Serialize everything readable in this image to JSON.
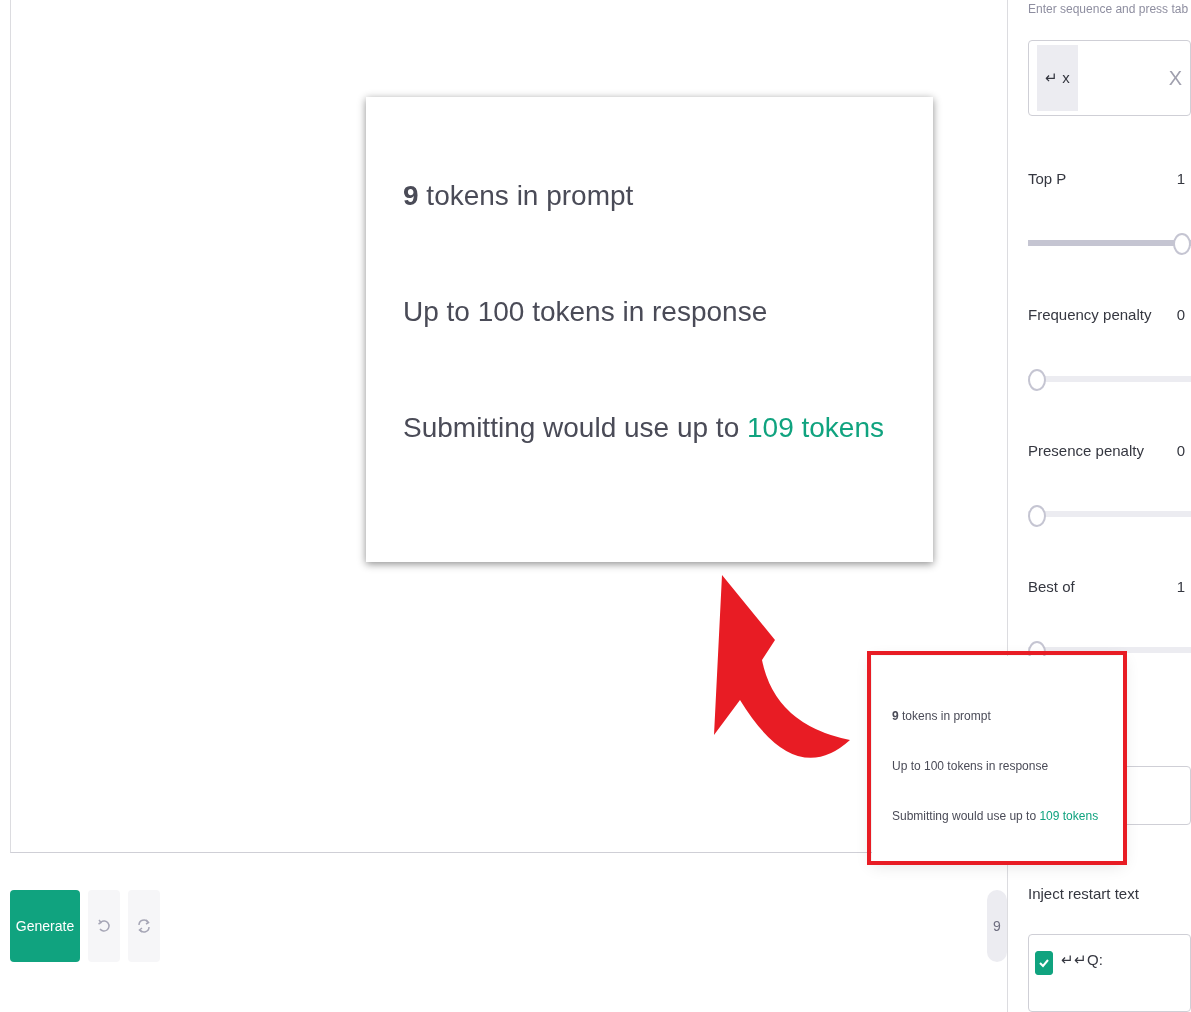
{
  "sidebar": {
    "stop_sequences": {
      "label": "Enter sequence and press tab",
      "chips": [
        {
          "text": "↵ x"
        }
      ],
      "clear": "X"
    },
    "sliders": [
      {
        "label": "Top P",
        "value": "1",
        "level": 1
      },
      {
        "label": "Frequency penalty",
        "value": "0",
        "level": 0
      },
      {
        "label": "Presence penalty",
        "value": "0",
        "level": 0
      },
      {
        "label": "Best of",
        "value": "1",
        "level": 0
      }
    ],
    "inject_restart": {
      "label": "Inject restart text",
      "checked": true,
      "value": "↵↵Q:"
    }
  },
  "toolbar": {
    "generate": "Generate",
    "token_count": "9"
  },
  "token_tooltip": {
    "lines": [
      {
        "text": "**9** tokens in prompt"
      },
      {
        "text": "Up to 100 tokens in response"
      },
      {
        "text": "Submitting would use up to ",
        "highlight": "109 tokens"
      }
    ]
  },
  "callout": {
    "lines": [
      {
        "text": "**9** tokens in prompt"
      },
      {
        "text": "Up to 100 tokens in response"
      },
      {
        "text": "Submitting would use up to ",
        "highlight": "109 tokens"
      }
    ]
  }
}
